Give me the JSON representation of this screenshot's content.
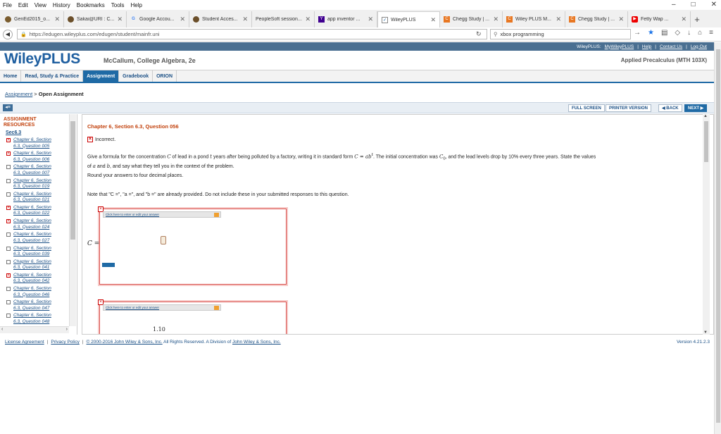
{
  "browser": {
    "menu": [
      "File",
      "Edit",
      "View",
      "History",
      "Bookmarks",
      "Tools",
      "Help"
    ],
    "tabs": [
      {
        "label": "GenEd2015_o...",
        "icon": "moodle-icon"
      },
      {
        "label": "Sakai@URI : C...",
        "icon": "sakai-icon"
      },
      {
        "label": "Google Accou...",
        "icon": "google-icon"
      },
      {
        "label": "Student Acces...",
        "icon": "student-icon"
      },
      {
        "label": "PeopleSoft session...",
        "icon": "peoplesoft-icon"
      },
      {
        "label": "app inventor ...",
        "icon": "yahoo-icon"
      },
      {
        "label": "WileyPLUS",
        "icon": "wiley-icon",
        "active": true
      },
      {
        "label": "Chegg Study | ...",
        "icon": "chegg-icon"
      },
      {
        "label": "Wiley PLUS M...",
        "icon": "chegg-icon"
      },
      {
        "label": "Chegg Study | ...",
        "icon": "chegg-icon"
      },
      {
        "label": "Fetty Wap ...",
        "icon": "youtube-icon"
      }
    ],
    "url": "https://edugen.wileyplus.com/edugen/student/mainfr.uni",
    "search": "xbox programming"
  },
  "topbar": {
    "wileyplus_label": "WileyPLUS:",
    "links": [
      "MyWileyPLUS",
      "Help",
      "Contact Us",
      "Log Out"
    ]
  },
  "header": {
    "logo": "WileyPLUS",
    "course": "McCallum, College Algebra, 2e",
    "class": "Applied Precalculus (MTH 103X)"
  },
  "tabs": [
    "Home",
    "Read, Study & Practice",
    "Assignment",
    "Gradebook",
    "ORION"
  ],
  "breadcrumb": {
    "link": "Assignment",
    "sep": ">",
    "current": "Open Assignment"
  },
  "toolbar": {
    "fullscreen": "FULL SCREEN",
    "printer": "PRINTER VERSION",
    "back": "◀ BACK",
    "next": "NEXT ▶"
  },
  "sidebar": {
    "heading": "ASSIGNMENT RESOURCES",
    "section": "Sec6.3",
    "items": [
      {
        "line1": "Chapter 6, Section",
        "line2": "6.3, Question 005",
        "status": "bad"
      },
      {
        "line1": "Chapter 6, Section",
        "line2": "6.3, Question 006",
        "status": "bad"
      },
      {
        "line1": "Chapter 6, Section",
        "line2": "6.3, Question 007",
        "status": "ok"
      },
      {
        "line1": "Chapter 6, Section",
        "line2": "6.3, Question 019",
        "status": "ok"
      },
      {
        "line1": "Chapter 6, Section",
        "line2": "6.3, Question 021",
        "status": "ok"
      },
      {
        "line1": "Chapter 6, Section",
        "line2": "6.3, Question 022",
        "status": "bad"
      },
      {
        "line1": "Chapter 6, Section",
        "line2": "6.3, Question 024",
        "status": "bad"
      },
      {
        "line1": "Chapter 6, Section",
        "line2": "6.3, Question 027",
        "status": "ok"
      },
      {
        "line1": "Chapter 6, Section",
        "line2": "6.3, Question 039",
        "status": "ok"
      },
      {
        "line1": "Chapter 6, Section",
        "line2": "6.3, Question 041",
        "status": "ok"
      },
      {
        "line1": "Chapter 6, Section",
        "line2": "6.3, Question 042",
        "status": "bad"
      },
      {
        "line1": "Chapter 6, Section",
        "line2": "6.3, Question 046",
        "status": "ok"
      },
      {
        "line1": "Chapter 6, Section",
        "line2": "6.3, Question 047",
        "status": "ok"
      },
      {
        "line1": "Chapter 6, Section",
        "line2": "6.3, Question 048",
        "status": "ok"
      }
    ]
  },
  "question": {
    "title": "Chapter 6, Section 6.3, Question 056",
    "result": "Incorrect.",
    "text_a": "Give a formula for the concentration ",
    "var_C": "C",
    "text_b": " of lead in a pond ",
    "var_t": "t",
    "text_c": " years after being polluted by a factory, writing it in standard form ",
    "formula": "C = ab",
    "formula_exp": "t",
    "text_d": ". The initial concentration was ",
    "var_C0": "C",
    "var_C0_sub": "0",
    "text_e": ", and the lead levels drop by ",
    "pct": "10%",
    "text_f": " every three years. State the values",
    "text_g": "of ",
    "var_a": "a",
    "text_h": " and ",
    "var_b": "b",
    "text_i": ", and say what they tell you in the context of the problem.",
    "round": "Round your answers to four decimal places.",
    "note": "Note that \"C =\", \"a =\", and \"b =\" are already provided. Do not include these in your submitted responses to this question.",
    "answer_hint": "Click here to enter or edit your answer",
    "c_label": "C =",
    "second_value": "1.10"
  },
  "footer": {
    "links": [
      "License Agreement",
      "Privacy Policy"
    ],
    "copyright": "© 2000-2016 John Wiley & Sons, Inc.",
    "rights": " All Rights Reserved. A Division of ",
    "company": "John Wiley & Sons, Inc.",
    "version": "Version 4.21.2.3"
  }
}
